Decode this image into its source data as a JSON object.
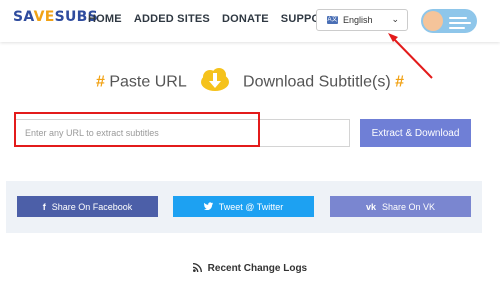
{
  "header": {
    "logo_part1": "SA",
    "logo_part2": "VE",
    "logo_part3": "SUBS",
    "nav": [
      "HOME",
      "ADDED SITES",
      "DONATE",
      "SUPPORT"
    ],
    "language": "English",
    "language_flag": "A文"
  },
  "main": {
    "hash": "#",
    "paste_url": "Paste URL",
    "download_subtitles": "Download Subtitle(s)",
    "url_placeholder": "Enter any URL to extract subtitles",
    "url_value": "",
    "extract_button": "Extract & Download"
  },
  "share": {
    "facebook": "Share On Facebook",
    "twitter": "Tweet @ Twitter",
    "vk": "Share On VK",
    "facebook_icon": "f",
    "vk_icon": "vk"
  },
  "footer": {
    "recent_logs": "Recent Change Logs"
  },
  "colors": {
    "accent": "#f1a215",
    "primary_button": "#6f7fd6",
    "highlight": "#e31b1b"
  }
}
